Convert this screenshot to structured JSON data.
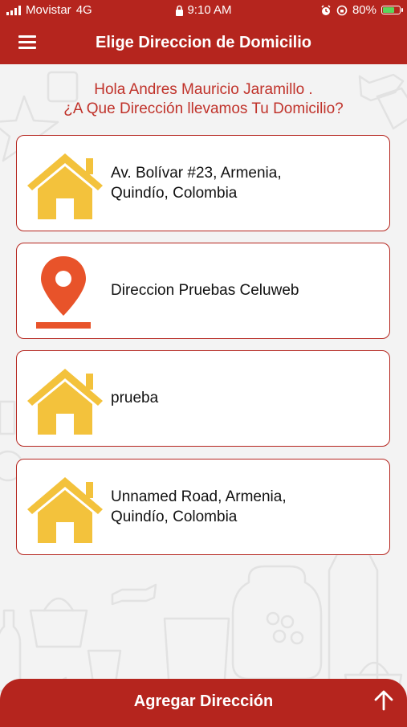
{
  "status_bar": {
    "carrier": "Movistar",
    "network": "4G",
    "time": "9:10 AM",
    "battery": "80%",
    "battery_level": 0.8
  },
  "app_bar": {
    "title": "Elige Direccion de Domicilio",
    "menu_icon": "hamburger-menu-icon"
  },
  "greeting": {
    "line1": "Hola Andres Mauricio Jaramillo .",
    "line2": "¿A Que Dirección llevamos Tu Domicilio?"
  },
  "addresses": [
    {
      "icon": "house-icon",
      "label": "Av. Bolívar #23, Armenia,\nQuindío, Colombia"
    },
    {
      "icon": "location-pin-icon",
      "label": "Direccion Pruebas Celuweb"
    },
    {
      "icon": "house-icon",
      "label": "prueba"
    },
    {
      "icon": "house-icon",
      "label": "Unnamed Road, Armenia,\nQuindío, Colombia"
    }
  ],
  "bottom_button": {
    "label": "Agregar Dirección",
    "icon": "arrow-up-icon"
  },
  "colors": {
    "primary": "#b5251e",
    "house": "#f3c23c",
    "pin": "#e8532a"
  }
}
